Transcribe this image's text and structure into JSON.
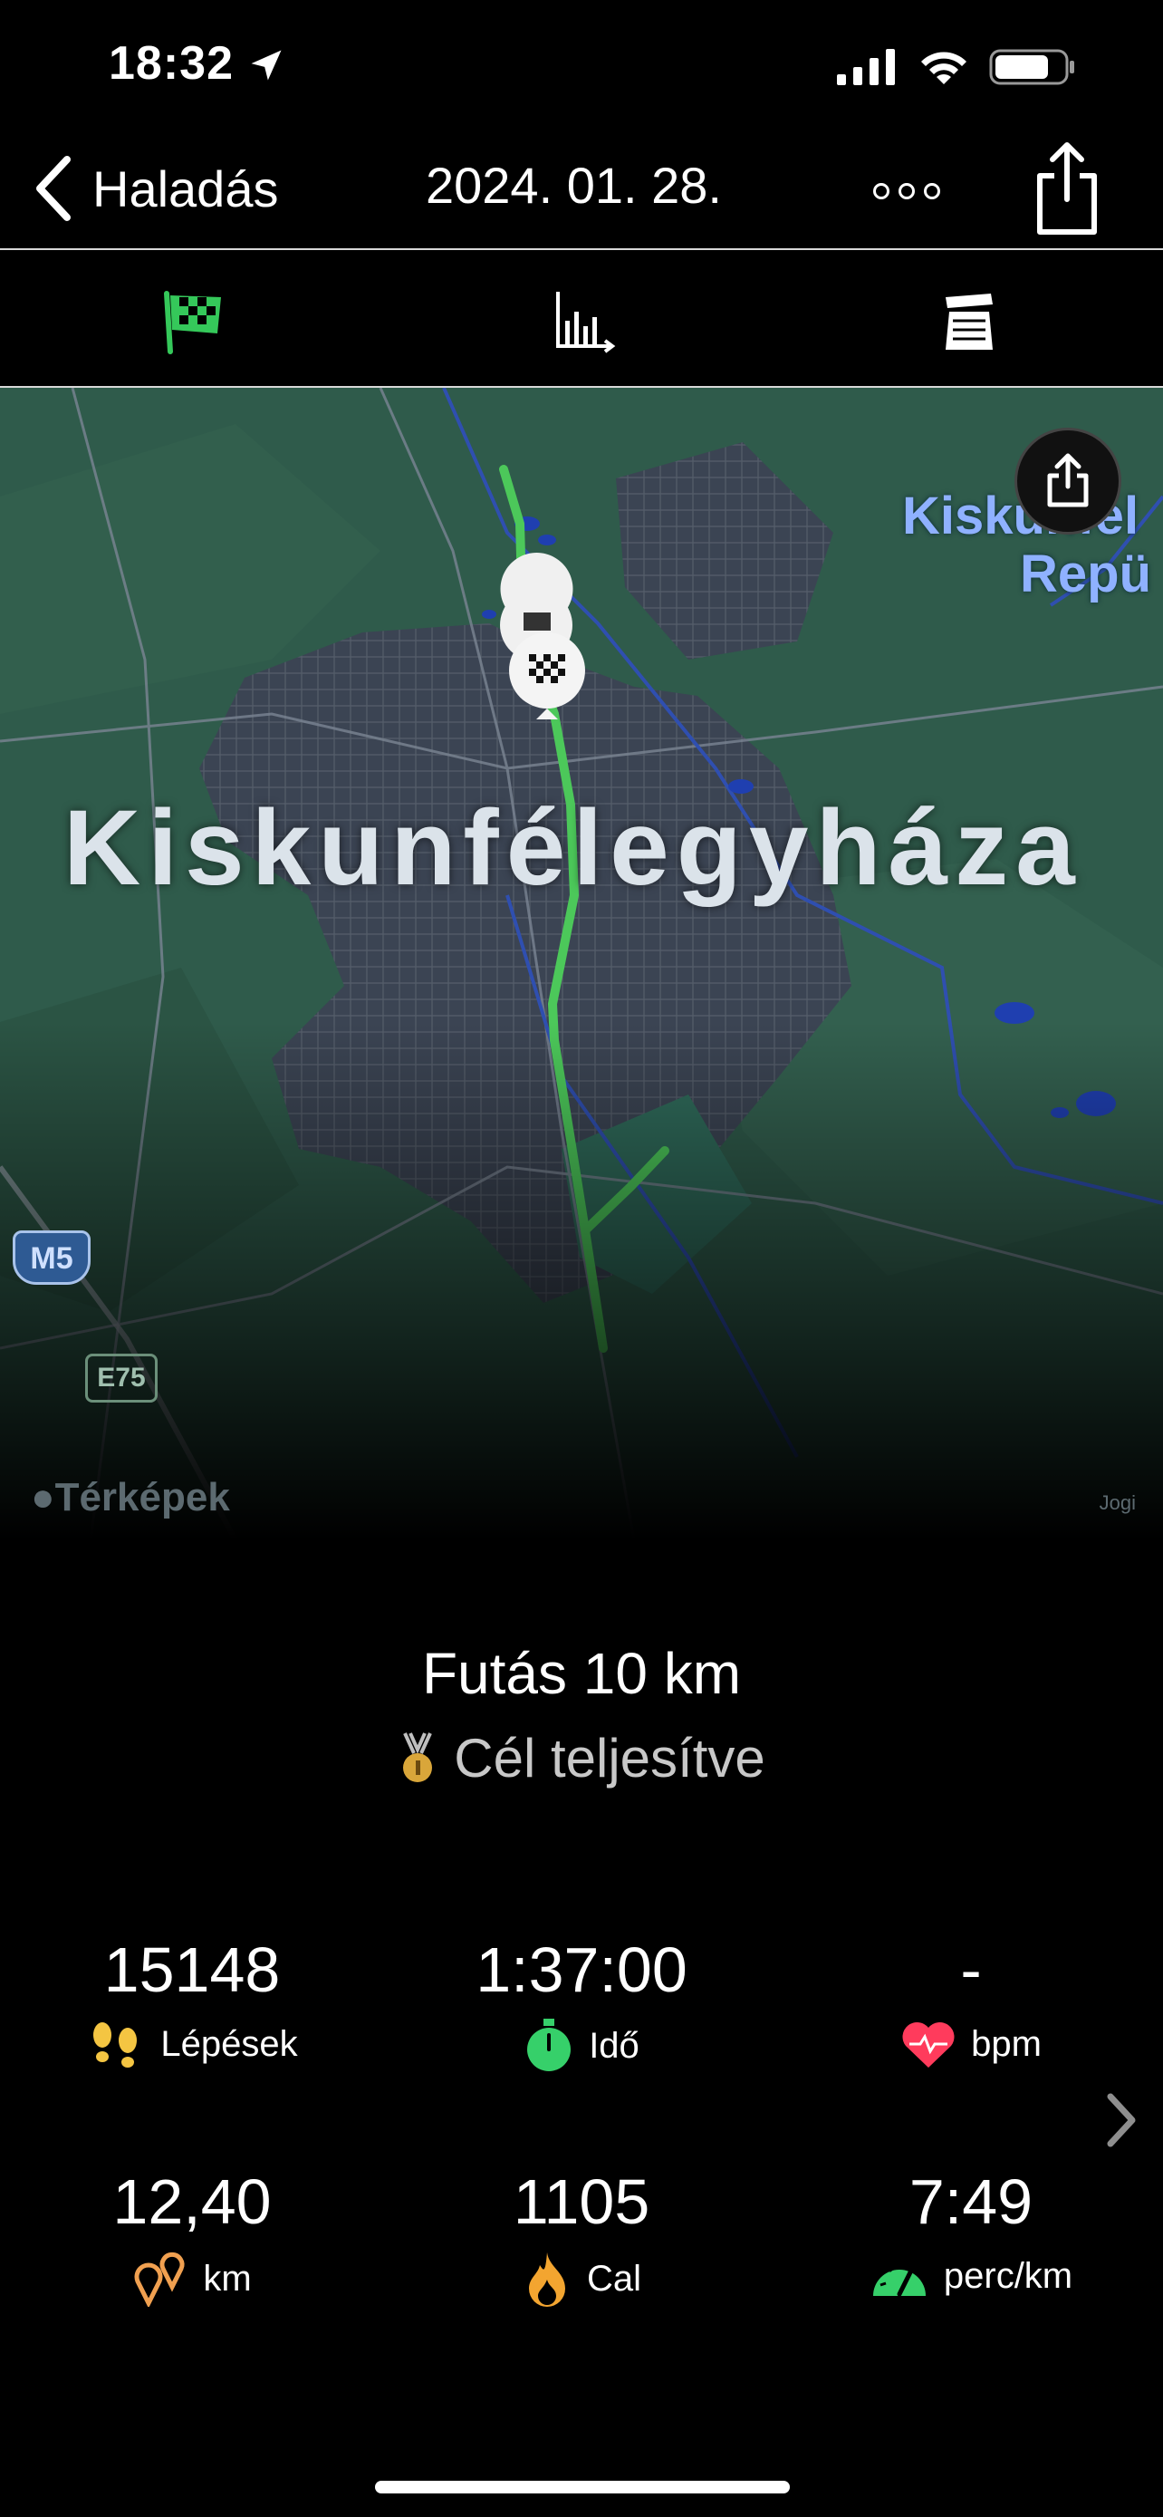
{
  "status_bar": {
    "time": "18:32"
  },
  "nav": {
    "back_label": "Haladás",
    "date": "2024. 01. 28."
  },
  "map": {
    "city_label": "Kiskunfélegyháza",
    "airport_label_line1": "Kiskunfél",
    "airport_label_line2": "Repü",
    "road_m5": "M5",
    "road_e75": "E75",
    "attribution": "Térképek",
    "legal": "Jogi"
  },
  "workout": {
    "title": "Futás 10 km",
    "goal_status": "Cél teljesítve"
  },
  "stats": {
    "steps": {
      "value": "15148",
      "label": "Lépések"
    },
    "time": {
      "value": "1:37:00",
      "label": "Idő"
    },
    "heart": {
      "value": "-",
      "label": "bpm"
    },
    "distance": {
      "value": "12,40",
      "label": "km"
    },
    "calories": {
      "value": "1105",
      "label": "Cal"
    },
    "pace": {
      "value": "7:49",
      "label": "perc/km"
    }
  },
  "colors": {
    "route": "#4cc85a",
    "accent_green": "#36d06a",
    "heart": "#ff3b5c"
  }
}
